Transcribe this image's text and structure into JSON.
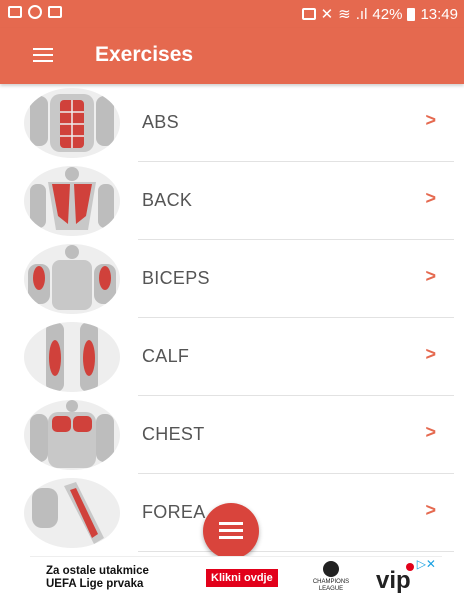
{
  "status_bar": {
    "battery": "42%",
    "time": "13:49"
  },
  "app_bar": {
    "title": "Exercises"
  },
  "exercises": [
    {
      "label": "ABS"
    },
    {
      "label": "BACK"
    },
    {
      "label": "BICEPS"
    },
    {
      "label": "CALF"
    },
    {
      "label": "CHEST"
    },
    {
      "label": "FOREA"
    }
  ],
  "chevron": ">",
  "ad": {
    "line1": "Za ostale utakmice",
    "line2": "UEFA Lige prvaka",
    "cta": "Klikni ovdje",
    "logo_text": "CHAMPIONS LEAGUE",
    "brand": "vip"
  },
  "colors": {
    "accent": "#e5694f",
    "fab": "#d9443c",
    "muscle_highlight": "#d0413b",
    "label_text": "#555555"
  },
  "icons": {
    "menu": "hamburger-menu-icon",
    "fab": "hamburger-fab-icon"
  }
}
